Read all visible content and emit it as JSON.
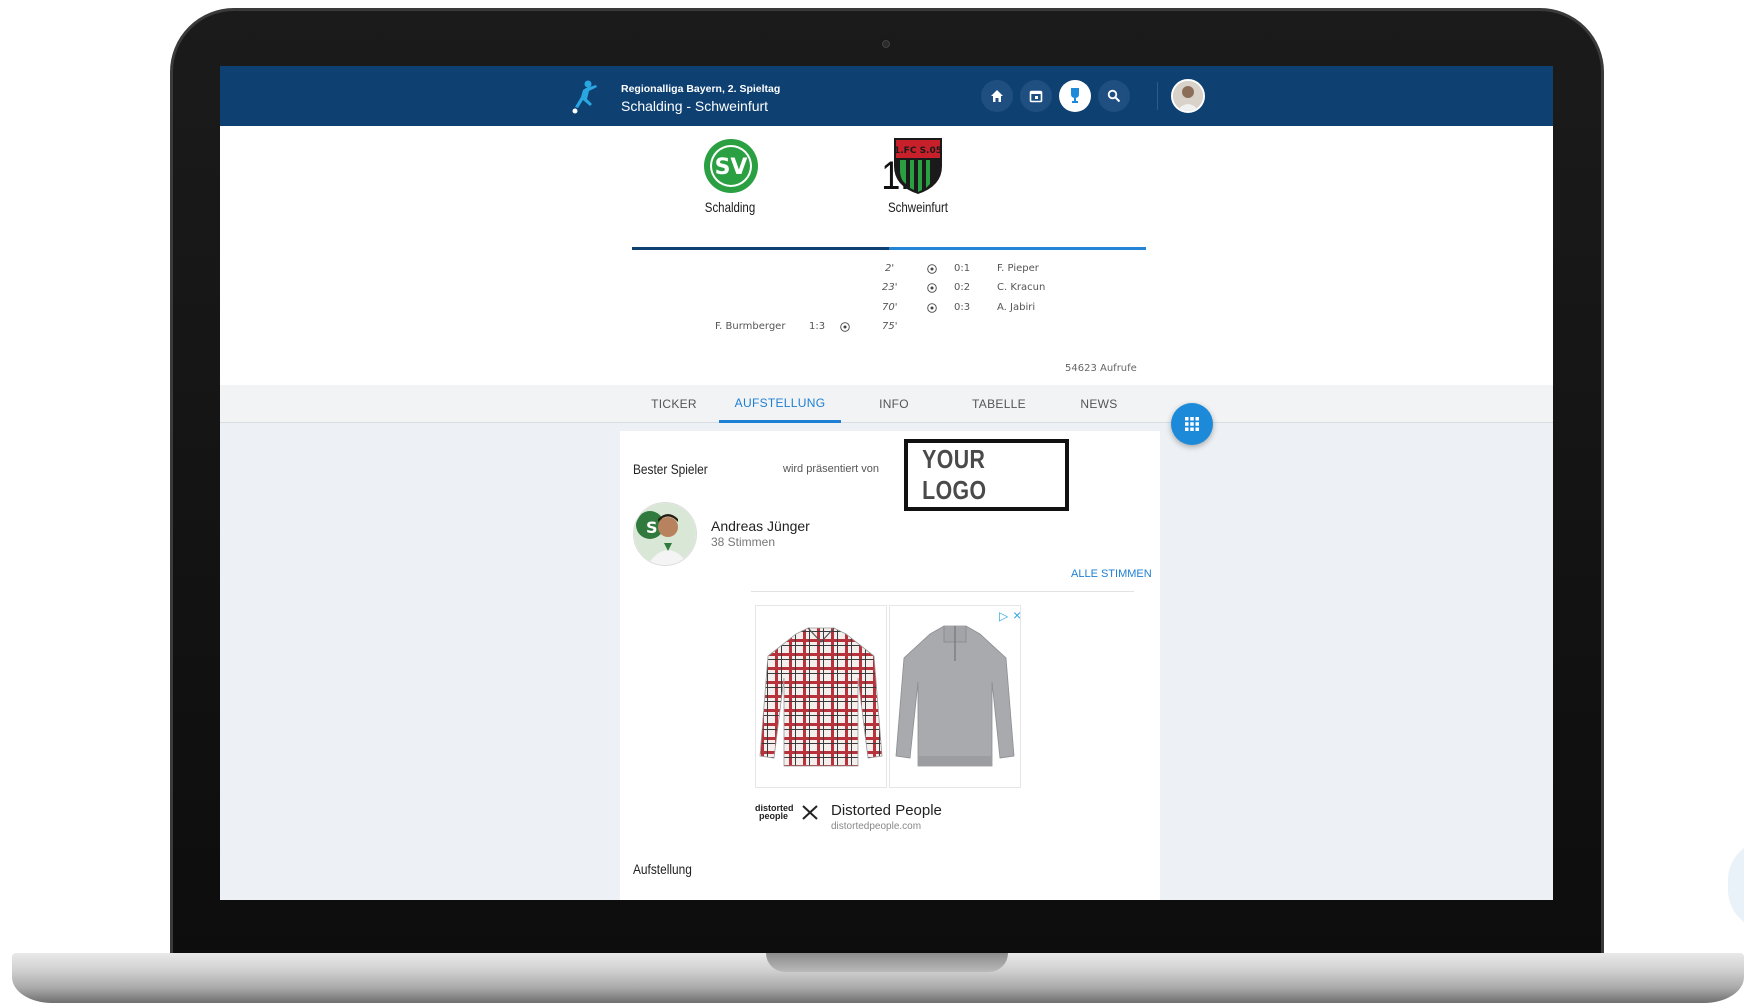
{
  "header": {
    "subtitle": "Regionalliga Bayern, 2. Spieltag",
    "title": "Schalding - Schweinfurt",
    "nav": [
      {
        "icon": "home-icon"
      },
      {
        "icon": "calendar-icon"
      },
      {
        "icon": "trophy-icon",
        "active": true
      },
      {
        "icon": "search-icon"
      }
    ]
  },
  "match": {
    "home_team": "Schalding",
    "away_team": "Schweinfurt",
    "score": "1:3",
    "goals": [
      {
        "minute": "2'",
        "score": "0:1",
        "scorer": "F. Pieper",
        "side": "away"
      },
      {
        "minute": "23'",
        "score": "0:2",
        "scorer": "C. Kracun",
        "side": "away"
      },
      {
        "minute": "70'",
        "score": "0:3",
        "scorer": "A. Jabiri",
        "side": "away"
      },
      {
        "minute": "75'",
        "score": "1:3",
        "scorer": "F. Burmberger",
        "side": "home"
      }
    ],
    "home_logo_text": "SV",
    "away_logo_text": "1.FC S.05",
    "views": "54623 Aufrufe"
  },
  "tabs": [
    {
      "label": "TICKER",
      "active": false
    },
    {
      "label": "AUFSTELLUNG",
      "active": true
    },
    {
      "label": "INFO",
      "active": false
    },
    {
      "label": "TABELLE",
      "active": false
    },
    {
      "label": "NEWS",
      "active": false
    }
  ],
  "best_player": {
    "section_title": "Bester Spieler",
    "presented_by": "wird präsentiert von",
    "sponsor_logo": "YOUR LOGO",
    "name": "Andreas Jünger",
    "votes": "38 Stimmen",
    "all_votes_label": "ALLE STIMMEN"
  },
  "ad": {
    "brand": "Distorted People",
    "url": "distortedpeople.com",
    "logo_line1": "distorted",
    "logo_line2": "people"
  },
  "lineup": {
    "section_title": "Aufstellung"
  },
  "colors": {
    "header_bg": "#0e4072",
    "accent": "#1d7fd3",
    "home_team": "#2aa043",
    "away_team": "#c8202b"
  }
}
